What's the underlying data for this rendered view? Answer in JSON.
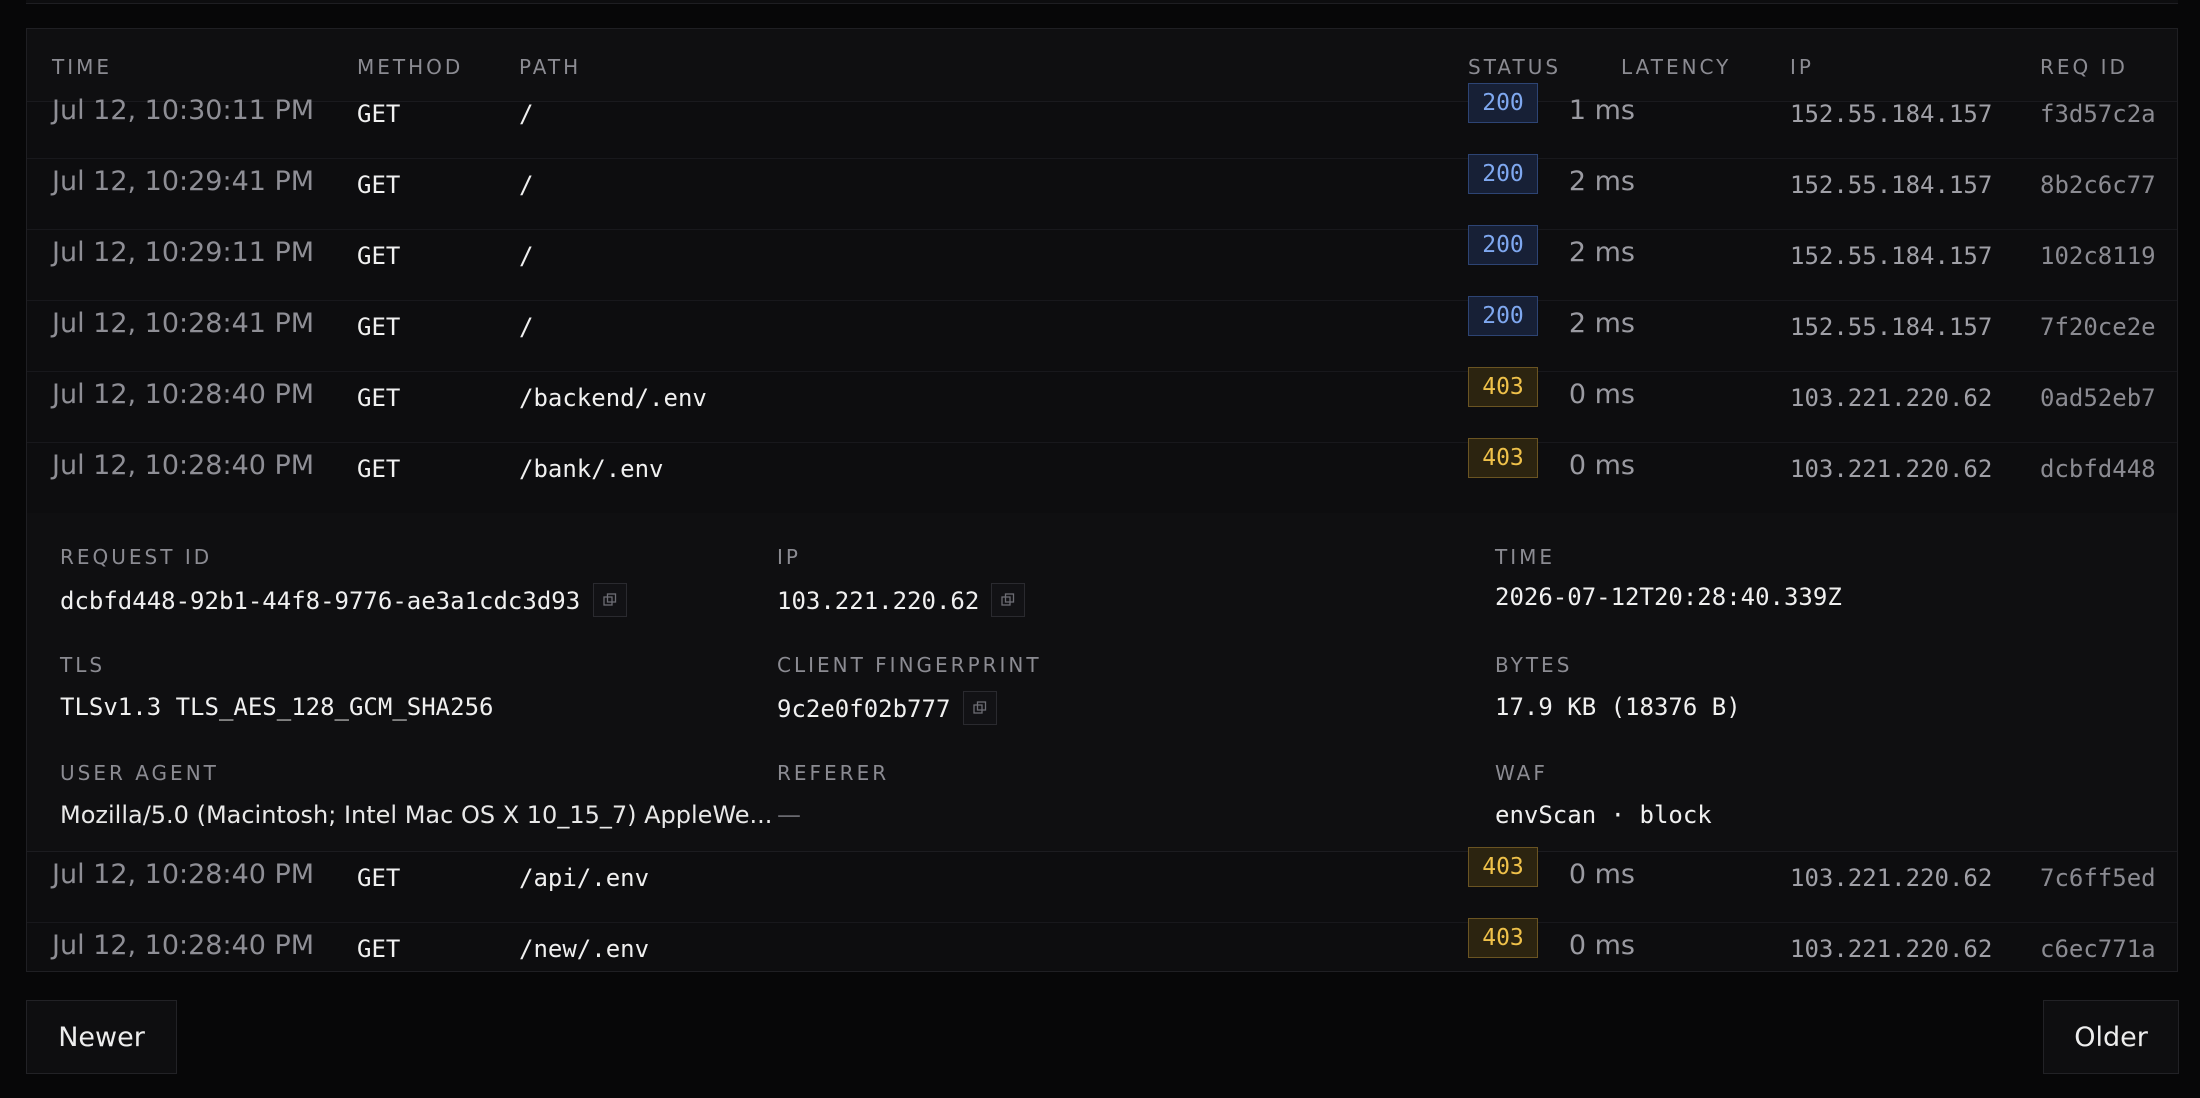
{
  "table": {
    "headers": {
      "time": "TIME",
      "method": "METHOD",
      "path": "PATH",
      "status": "STATUS",
      "latency": "LATENCY",
      "ip": "IP",
      "req_id": "REQ ID"
    },
    "rows_before": [
      {
        "time": "Jul 12, 10:30:11 PM",
        "method": "GET",
        "path": "/",
        "status": "200",
        "latency": "1 ms",
        "ip": "152.55.184.157",
        "req_id": "f3d57c2a"
      },
      {
        "time": "Jul 12, 10:29:41 PM",
        "method": "GET",
        "path": "/",
        "status": "200",
        "latency": "2 ms",
        "ip": "152.55.184.157",
        "req_id": "8b2c6c77"
      },
      {
        "time": "Jul 12, 10:29:11 PM",
        "method": "GET",
        "path": "/",
        "status": "200",
        "latency": "2 ms",
        "ip": "152.55.184.157",
        "req_id": "102c8119"
      },
      {
        "time": "Jul 12, 10:28:41 PM",
        "method": "GET",
        "path": "/",
        "status": "200",
        "latency": "2 ms",
        "ip": "152.55.184.157",
        "req_id": "7f20ce2e"
      },
      {
        "time": "Jul 12, 10:28:40 PM",
        "method": "GET",
        "path": "/backend/.env",
        "status": "403",
        "latency": "0 ms",
        "ip": "103.221.220.62",
        "req_id": "0ad52eb7"
      },
      {
        "time": "Jul 12, 10:28:40 PM",
        "method": "GET",
        "path": "/bank/.env",
        "status": "403",
        "latency": "0 ms",
        "ip": "103.221.220.62",
        "req_id": "dcbfd448"
      }
    ],
    "rows_after": [
      {
        "time": "Jul 12, 10:28:40 PM",
        "method": "GET",
        "path": "/api/.env",
        "status": "403",
        "latency": "0 ms",
        "ip": "103.221.220.62",
        "req_id": "7c6ff5ed"
      },
      {
        "time": "Jul 12, 10:28:40 PM",
        "method": "GET",
        "path": "/new/.env",
        "status": "403",
        "latency": "0 ms",
        "ip": "103.221.220.62",
        "req_id": "c6ec771a"
      }
    ]
  },
  "detail": {
    "request_id_label": "REQUEST ID",
    "request_id": "dcbfd448-92b1-44f8-9776-ae3a1cdc3d93",
    "ip_label": "IP",
    "ip": "103.221.220.62",
    "time_label": "TIME",
    "time": "2026-07-12T20:28:40.339Z",
    "tls_label": "TLS",
    "tls": "TLSv1.3 TLS_AES_128_GCM_SHA256",
    "fingerprint_label": "CLIENT FINGERPRINT",
    "fingerprint": "9c2e0f02b777",
    "bytes_label": "BYTES",
    "bytes": "17.9 KB (18376 B)",
    "user_agent_label": "USER AGENT",
    "user_agent": "Mozilla/5.0 (Macintosh; Intel Mac OS X 10_15_7) AppleWe...",
    "referer_label": "REFERER",
    "referer": "—",
    "waf_label": "WAF",
    "waf": "envScan · block"
  },
  "pagination": {
    "newer_label": "Newer",
    "older_label": "Older"
  },
  "colors": {
    "status_200": "#7fa8f0",
    "status_403": "#efc14a"
  },
  "icons": {
    "copy": "copy-icon"
  }
}
